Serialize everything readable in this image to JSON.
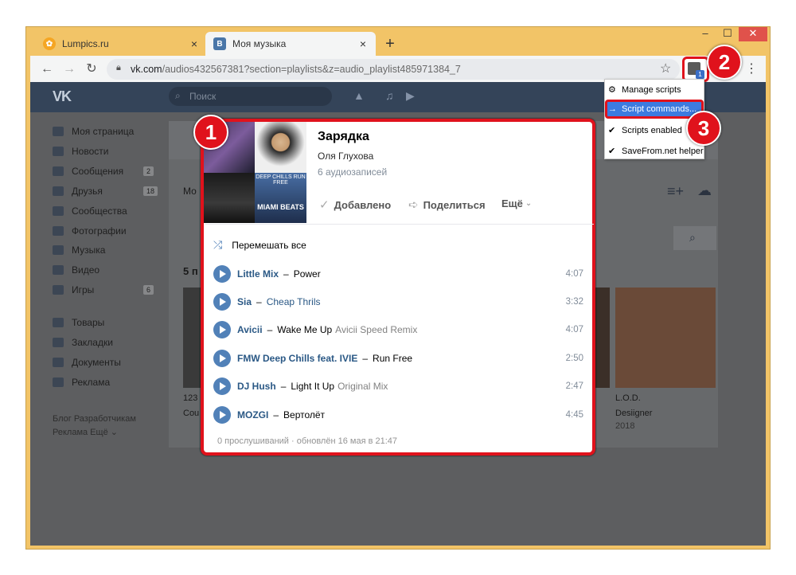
{
  "browser": {
    "tabs": [
      {
        "title": "Lumpics.ru",
        "icon": "lumpics-favicon",
        "color": "#f5a623"
      },
      {
        "title": "Моя музыка",
        "icon": "vk-favicon",
        "color": "#4a76a8"
      }
    ],
    "url_prefix": "vk.com",
    "url_rest": "/audios432567381?section=playlists&z=audio_playlist485971384_7",
    "new_tab": "+",
    "close_glyph": "×"
  },
  "vk": {
    "logo": "VK",
    "search_placeholder": "Поиск",
    "sidebar": [
      {
        "label": "Моя страница"
      },
      {
        "label": "Новости"
      },
      {
        "label": "Сообщения",
        "count": "2"
      },
      {
        "label": "Друзья",
        "count": "18"
      },
      {
        "label": "Сообщества"
      },
      {
        "label": "Фотографии"
      },
      {
        "label": "Музыка"
      },
      {
        "label": "Видео"
      },
      {
        "label": "Игры",
        "count": "6"
      },
      {
        "label": "Товары"
      },
      {
        "label": "Закладки"
      },
      {
        "label": "Документы"
      },
      {
        "label": "Реклама"
      }
    ],
    "footer_line1": "Блог  Разработчикам",
    "footer_line2": "Реклама  Ещё ⌄",
    "bg_items": {
      "tab_label": "Мо",
      "section": "5 п",
      "album1_title": "123",
      "album1_sub": "Cou",
      "album2_title": "L.O.D.",
      "album2_sub": "Desiigner",
      "album2_year": "2018"
    }
  },
  "playlist": {
    "title": "Зарядка",
    "owner": "Оля Глухова",
    "count": "6 аудиозаписей",
    "actions": {
      "added": "Добавлено",
      "share": "Поделиться",
      "more": "Ещё"
    },
    "shuffle": "Перемешать все",
    "covers": [
      "cover-little-mix",
      "cover-sia",
      "cover-deep-chills",
      "cover-miami-beats"
    ],
    "cover_text": {
      "miami": "MIAMI BEATS",
      "deep": "DEEP CHILLS RUN FREE"
    },
    "tracks": [
      {
        "artist": "Little Mix",
        "title": "Power",
        "sub": "",
        "duration": "4:07",
        "title_link": false
      },
      {
        "artist": "Sia",
        "title": "Cheap Thrils",
        "sub": "",
        "duration": "3:32",
        "title_link": true
      },
      {
        "artist": "Avicii",
        "title": "Wake Me Up",
        "sub": "Avicii Speed Remix",
        "duration": "4:07",
        "title_link": false
      },
      {
        "artist": "FMW Deep Chills feat. IVIE",
        "title": "Run Free",
        "sub": "",
        "duration": "2:50",
        "title_link": false
      },
      {
        "artist": "DJ Hush",
        "title": "Light It Up",
        "sub": "Original Mix",
        "duration": "2:47",
        "title_link": false
      },
      {
        "artist": "MOZGI",
        "title": "Вертолёт",
        "sub": "",
        "duration": "4:45",
        "title_link": false
      }
    ],
    "footer": "0 прослушиваний · обновлён 16 мая в 21:47"
  },
  "ext_menu": {
    "items": [
      {
        "label": "Manage scripts",
        "icon": "gear-icon"
      },
      {
        "label": "Script commands...",
        "icon": "arrow-right-icon"
      },
      {
        "label": "Scripts enabled",
        "icon": "check-icon"
      },
      {
        "label": "SaveFrom.net helper",
        "icon": "check-icon"
      }
    ],
    "badge_count": "1"
  },
  "annotations": [
    "1",
    "2",
    "3"
  ],
  "colors": {
    "highlight": "#e0121c",
    "vk_blue": "#5181b8",
    "frame": "#f2c467",
    "menu_active": "#3c7be0"
  }
}
